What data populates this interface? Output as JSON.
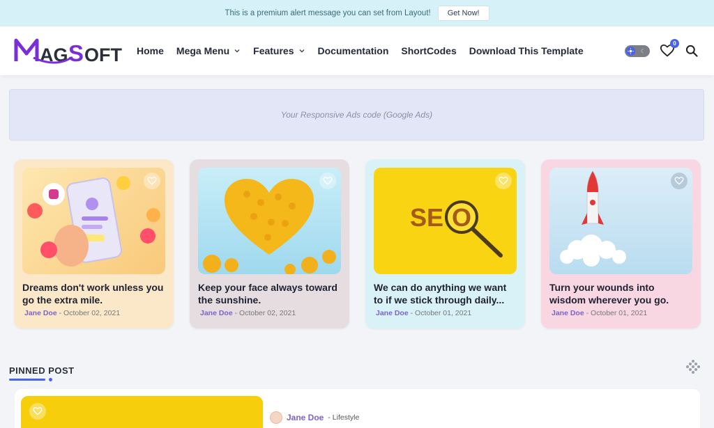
{
  "alert": {
    "message": "This is a premium alert message you can set from Layout!",
    "button": "Get Now!"
  },
  "brand": {
    "logo_text": "MagSoft",
    "logo_part1": "MAG",
    "logo_part2": "SOFT"
  },
  "nav": [
    {
      "label": "Home",
      "dropdown": false
    },
    {
      "label": "Mega Menu",
      "dropdown": true
    },
    {
      "label": "Features",
      "dropdown": true
    },
    {
      "label": "Documentation",
      "dropdown": false
    },
    {
      "label": "ShortCodes",
      "dropdown": false
    },
    {
      "label": "Download This Template",
      "dropdown": false
    }
  ],
  "header_icons": {
    "toggle": "dark-mode-toggle",
    "favorites_count": "0",
    "favorites_icon": "heart-icon",
    "search_icon": "search-icon"
  },
  "ad": {
    "text": "Your Responsive Ads code (Google Ads)"
  },
  "cards": [
    {
      "title": "Dreams don't work unless you go the extra mile.",
      "author": "Jane Doe",
      "date": "October 02, 2021",
      "bg": "#fbe8c8",
      "image": "social-media-phone"
    },
    {
      "title": "Keep your face always toward the sunshine.",
      "author": "Jane Doe",
      "date": "October 02, 2021",
      "bg": "#e5dde0",
      "image": "emoji-heart"
    },
    {
      "title": "We can do anything we want to if we stick through daily...",
      "author": "Jane Doe",
      "date": "October 01, 2021",
      "bg": "#d8f2f8",
      "image": "seo-magnifier"
    },
    {
      "title": "Turn your wounds into wisdom wherever you go.",
      "author": "Jane Doe",
      "date": "October 01, 2021",
      "bg": "#f8d7e2",
      "image": "rocket-launch"
    }
  ],
  "pinned": {
    "heading": "PINNED POST",
    "author": "Jane Doe",
    "category": "Lifestyle",
    "separator": "-"
  },
  "colors": {
    "accent": "#4a63e8",
    "author": "#7c63c9",
    "logo": "#7a2fd6"
  }
}
